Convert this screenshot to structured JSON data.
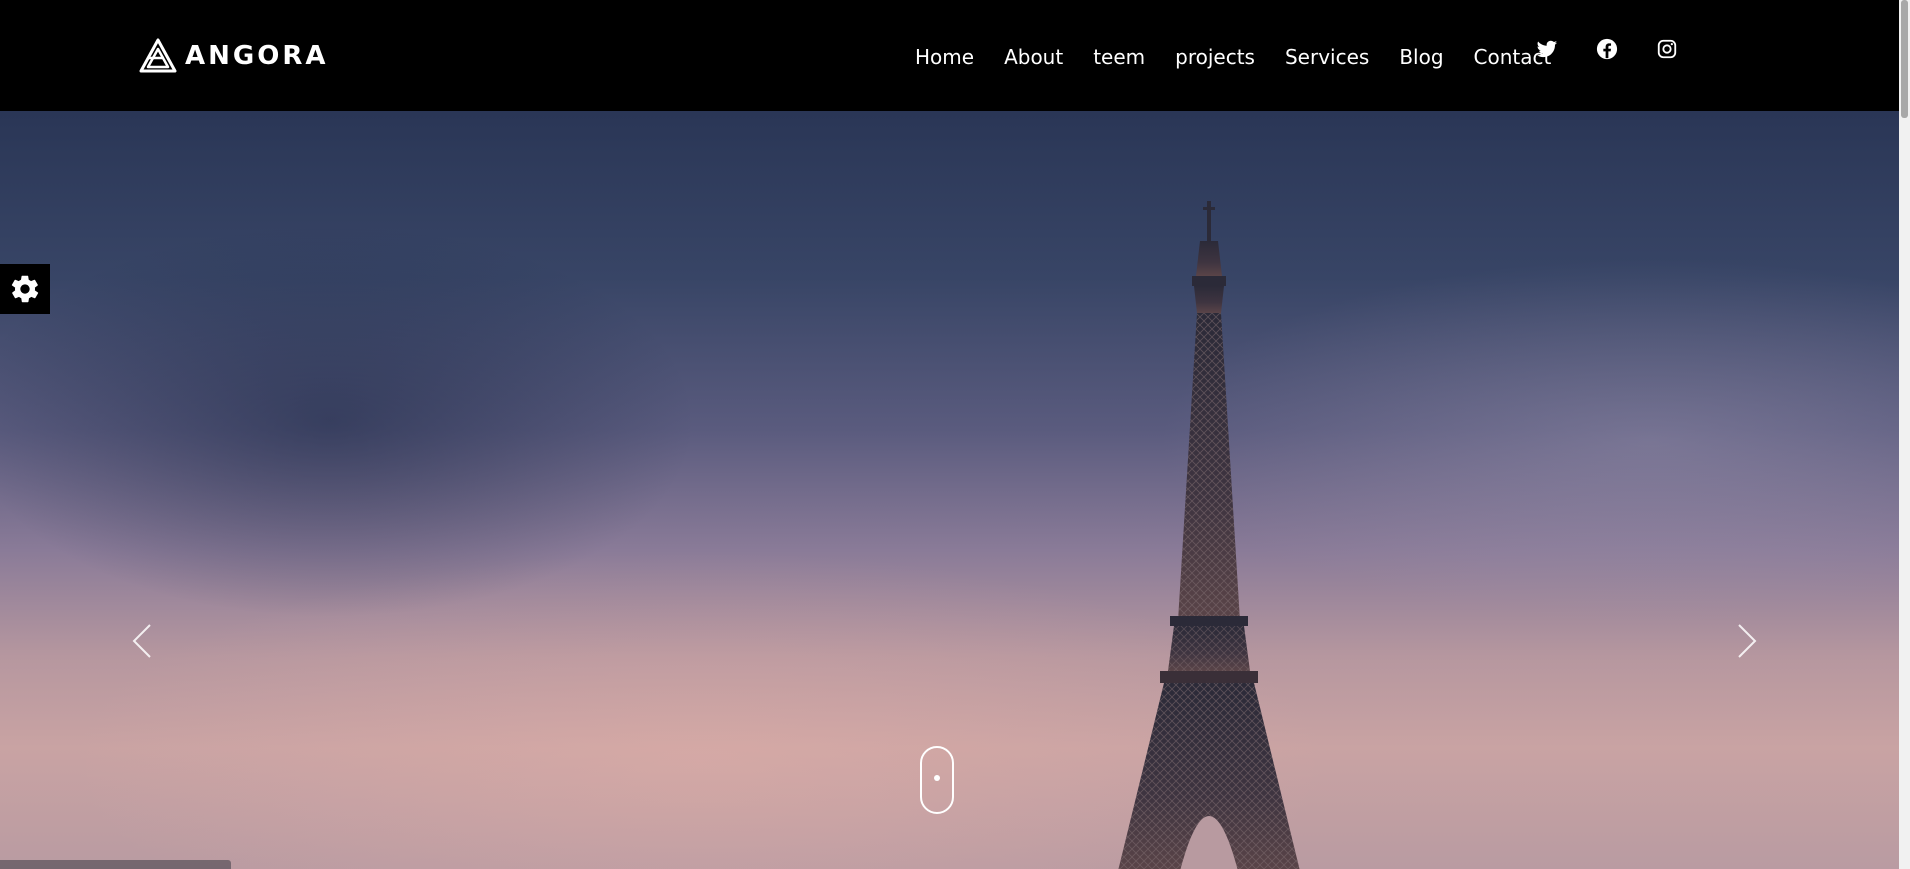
{
  "brand": {
    "name": "ANGORA",
    "logo_icon": "angora-triangle-logo"
  },
  "nav": {
    "items": [
      {
        "label": "Home"
      },
      {
        "label": "About"
      },
      {
        "label": "teem"
      },
      {
        "label": "projects"
      },
      {
        "label": "Services"
      },
      {
        "label": "Blog"
      },
      {
        "label": "Contact"
      }
    ]
  },
  "social": [
    {
      "icon": "twitter-icon"
    },
    {
      "icon": "facebook-icon"
    },
    {
      "icon": "instagram-icon"
    }
  ],
  "hero": {
    "image": "eiffel-tower-sunset-sky",
    "prev_icon": "chevron-left-icon",
    "next_icon": "chevron-right-icon",
    "scroll_icon": "mouse-scroll-icon"
  },
  "settings": {
    "icon": "gear-icon"
  },
  "colors": {
    "header_bg": "#000000",
    "text": "#ffffff"
  }
}
